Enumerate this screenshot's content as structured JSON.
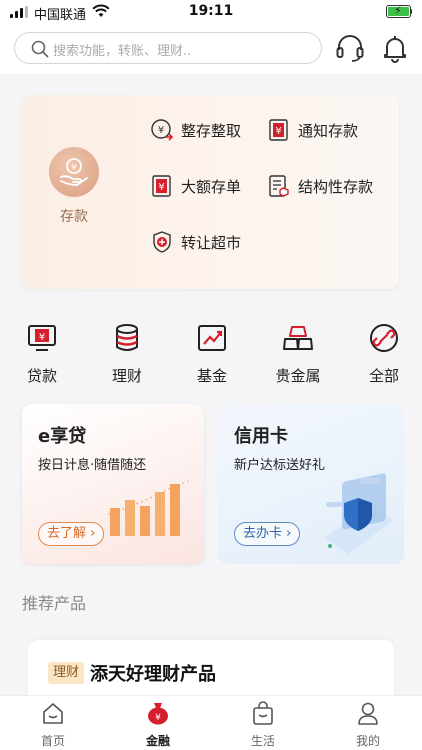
{
  "status_bar": {
    "carrier": "中国联通",
    "time": "19:11"
  },
  "search": {
    "placeholder": "搜索功能，转账、理财.."
  },
  "header_icons": [
    {
      "name": "customer-service-icon"
    },
    {
      "name": "notification-bell-icon"
    }
  ],
  "deposit": {
    "main_label": "存款",
    "items": [
      {
        "label": "整存整取",
        "icon": "lump-sum-deposit-icon"
      },
      {
        "label": "通知存款",
        "icon": "notice-deposit-icon"
      },
      {
        "label": "大额存单",
        "icon": "large-cd-icon"
      },
      {
        "label": "结构性存款",
        "icon": "structured-deposit-icon"
      },
      {
        "label": "转让超市",
        "icon": "transfer-market-icon"
      }
    ]
  },
  "categories": [
    {
      "label": "贷款",
      "icon": "loan-icon"
    },
    {
      "label": "理财",
      "icon": "wealth-management-icon"
    },
    {
      "label": "基金",
      "icon": "fund-icon"
    },
    {
      "label": "贵金属",
      "icon": "precious-metal-icon"
    },
    {
      "label": "全部",
      "icon": "all-services-icon"
    }
  ],
  "promos": {
    "loan": {
      "title": "e享贷",
      "subtitle": "按日计息·随借随还",
      "button": "去了解"
    },
    "credit_card": {
      "title": "信用卡",
      "subtitle": "新户达标送好礼",
      "button": "去办卡"
    }
  },
  "recommended": {
    "section_title": "推荐产品",
    "product": {
      "tag": "理财",
      "name": "添天好理财产品"
    }
  },
  "tabbar": [
    {
      "label": "首页",
      "icon": "home-icon",
      "active": false
    },
    {
      "label": "金融",
      "icon": "finance-bag-icon",
      "active": true
    },
    {
      "label": "生活",
      "icon": "life-shopping-bag-icon",
      "active": false
    },
    {
      "label": "我的",
      "icon": "profile-icon",
      "active": false
    }
  ],
  "colors": {
    "brand_red": "#d4202c",
    "deposit_accent": "#d99f82",
    "loan_orange": "#f0a25a",
    "card_blue": "#2d67a8"
  }
}
